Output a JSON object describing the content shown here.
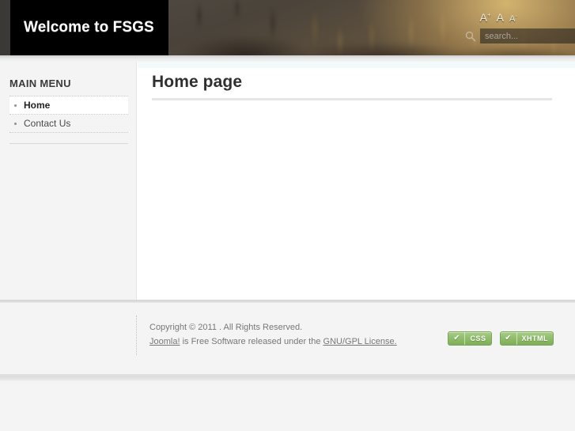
{
  "header": {
    "logo_text": "Welcome to FSGS",
    "font_sizer": {
      "increase_label": "A",
      "increase_sup": "+",
      "normal_label": "A",
      "decrease_label": "A",
      "decrease_sup": "-"
    },
    "search": {
      "placeholder": "search...",
      "value": "",
      "icon": "magnifier-icon"
    }
  },
  "sidebar": {
    "title": "MAIN MENU",
    "items": [
      {
        "label": "Home",
        "active": true
      },
      {
        "label": "Contact Us",
        "active": false
      }
    ]
  },
  "content": {
    "page_title": "Home page"
  },
  "footer": {
    "copyright_line": "Copyright © 2011 . All Rights Reserved.",
    "license_prefix": "Joomla!",
    "license_middle": " is Free Software released under the ",
    "license_link": "GNU/GPL License.",
    "badges": [
      {
        "check": "✔",
        "label": "CSS"
      },
      {
        "check": "✔",
        "label": "XHTML"
      }
    ]
  },
  "colors": {
    "logo_bg": "#000000",
    "sidebar_bg": "#f4f4f4",
    "content_bg": "#ffffff",
    "badge_green": "#8fbd6a",
    "text_dark": "#2f2f2f",
    "text_muted": "#777777"
  }
}
